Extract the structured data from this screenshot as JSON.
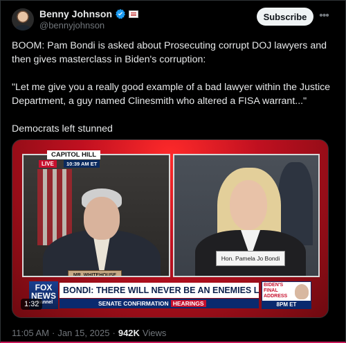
{
  "author": {
    "display_name": "Benny Johnson",
    "handle": "@bennyjohnson",
    "verified": true,
    "affiliation_icon": "flag-badge-icon"
  },
  "actions": {
    "subscribe_label": "Subscribe",
    "more_icon": "more-icon"
  },
  "tweet": {
    "paragraphs": [
      "BOOM: Pam Bondi is asked about Prosecuting corrupt DOJ lawyers and then gives masterclass in Biden's corruption:",
      "\"Let me give you a really good example of a bad lawyer within the Justice Department, a guy named Clinesmith who altered a FISA warrant...\"",
      "Democrats left stunned"
    ]
  },
  "video": {
    "location": "CAPITOL HILL",
    "live": "LIVE",
    "time": "10:39 AM ET",
    "left_nameplate": "MR. WHITEHOUSE",
    "right_nameplate": "Hon. Pamela Jo Bondi",
    "headline": "BONDI: THERE WILL NEVER BE AN ENEMIES LIST AT DOJ",
    "subheadline_prefix": "SENATE CONFIRMATION",
    "subheadline_highlight": "HEARINGS",
    "network_top": "FOX",
    "network_bottom": "NEWS",
    "network_sub": "channel",
    "promo_title": "BIDEN'S FINAL ADDRESS",
    "promo_time": "8PM ET",
    "duration": "1:32"
  },
  "meta": {
    "time": "11:05 AM",
    "separator": "·",
    "date": "Jan 15, 2025",
    "views_count": "942K",
    "views_label": "Views"
  },
  "colors": {
    "accent_verified": "#1d9bf0",
    "fox_red": "#c8102e",
    "fox_blue": "#0a2a6e"
  }
}
